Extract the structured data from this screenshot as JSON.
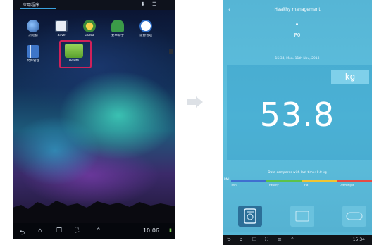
{
  "left_screen": {
    "tab_label": "应用程序",
    "apps": [
      {
        "label": "浏览器",
        "color": "#4a7fc2",
        "icon": "browser-icon"
      },
      {
        "label": "Save",
        "color": "#5a6e8a",
        "icon": "floppy-icon"
      },
      {
        "label": "GoWa",
        "color": "#d3a21a",
        "icon": "settings-icon"
      },
      {
        "label": "安卓助手",
        "color": "#3b9b48",
        "icon": "android-icon"
      },
      {
        "label": "设备管理",
        "color": "#2f6fc8",
        "icon": "hand-icon"
      },
      {
        "label": "文件管理",
        "color": "#3e76c9",
        "icon": "grid-icon"
      },
      {
        "label": "Health",
        "color": "#7cc243",
        "icon": "health-app-icon"
      }
    ],
    "page_dots": "• •",
    "clock": "10:06",
    "status_glyph": "▮"
  },
  "right_screen": {
    "title": "Healthy management",
    "user": "P0",
    "date": "15:34, Mon. 11th Nov, 2013",
    "unit": "kg",
    "weight": "53.8",
    "comparison": "Data compares with last time: 0.0 kg",
    "bmi_label": "BMI",
    "segments": [
      {
        "label": "Thin",
        "color": "#3f6fd0"
      },
      {
        "label": "Healthy",
        "color": "#5cc24a"
      },
      {
        "label": "Fat",
        "color": "#f0c531"
      },
      {
        "label": "Overweight",
        "color": "#e44b44"
      }
    ],
    "clock": "15:34"
  }
}
